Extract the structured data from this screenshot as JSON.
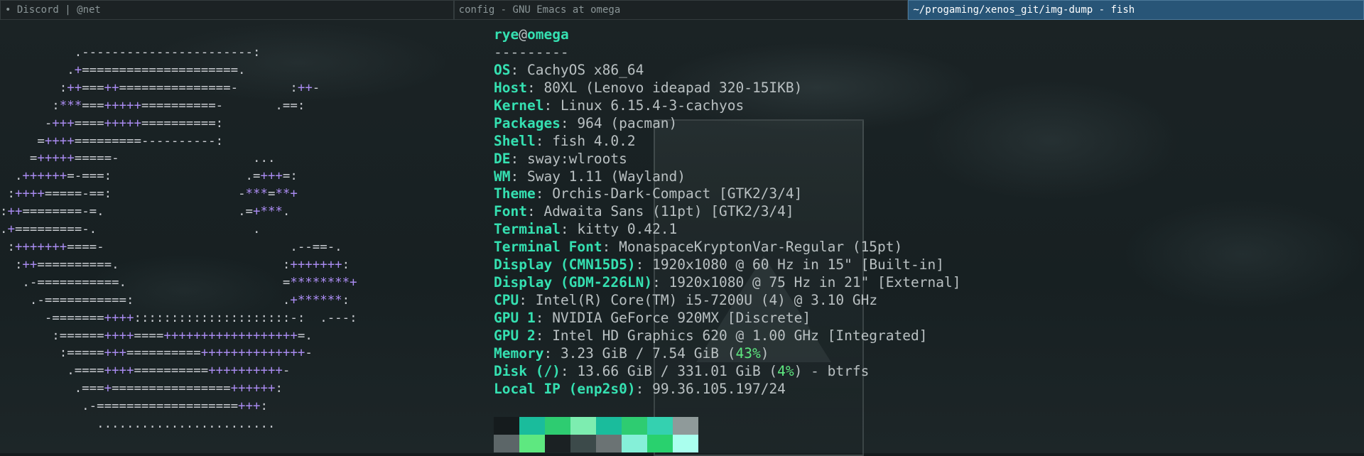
{
  "windows": [
    {
      "title": "• Discord | @net"
    },
    {
      "title": "config - GNU Emacs at omega"
    },
    {
      "title": "~/progaming/xenos_git/img-dump - fish"
    }
  ],
  "ascii_art": [
    "          .-----------------------:",
    "         .+=====================.",
    "        :++===++===============-       :++-",
    "       :***===+++++==========-       .==:",
    "      -+++====+++++==========:",
    "     =++++=========----------:",
    "    =+++++=====-                  ...",
    "  .++++++=-===:                  .=+++=:",
    " :++++=====-==:                 -***=**+",
    ":++========-=.                  .=+***.",
    ".+=========-.                     .",
    " :+++++++====-                         .--==-.",
    "  :++==========.                      :+++++++:",
    "   .-===========.                     =********+",
    "    .-===========:                    .+******:",
    "      -=======++++:::::::::::::::::::::-:  .---:",
    "       :======++++====++++++++++++++++++=.",
    "        :=====+++==========++++++++++++++-",
    "         .====++++==========++++++++++-",
    "          .===+================++++++:",
    "           .-===================+++:",
    "             ........................"
  ],
  "user": "rye",
  "at": "@",
  "host": "omega",
  "separator": "---------",
  "info": [
    {
      "key": "OS",
      "value": "CachyOS x86_64"
    },
    {
      "key": "Host",
      "value": "80XL (Lenovo ideapad 320-15IKB)"
    },
    {
      "key": "Kernel",
      "value": "Linux 6.15.4-3-cachyos"
    },
    {
      "key": "Packages",
      "value": "964 (pacman)"
    },
    {
      "key": "Shell",
      "value": "fish 4.0.2"
    },
    {
      "key": "DE",
      "value": "sway:wlroots"
    },
    {
      "key": "WM",
      "value": "Sway 1.11 (Wayland)"
    },
    {
      "key": "Theme",
      "value": "Orchis-Dark-Compact [GTK2/3/4]"
    },
    {
      "key": "Font",
      "value": "Adwaita Sans (11pt) [GTK2/3/4]"
    },
    {
      "key": "Terminal",
      "value": "kitty 0.42.1"
    },
    {
      "key": "Terminal Font",
      "value": "MonaspaceKryptonVar-Regular (15pt)"
    },
    {
      "key": "Display (CMN15D5)",
      "value": "1920x1080 @ 60 Hz in 15\" [Built-in]"
    },
    {
      "key": "Display (GDM-226LN)",
      "value": "1920x1080 @ 75 Hz in 21\" [External]"
    },
    {
      "key": "CPU",
      "value": "Intel(R) Core(TM) i5-7200U (4) @ 3.10 GHz"
    },
    {
      "key": "GPU 1",
      "value": "NVIDIA GeForce 920MX [Discrete]"
    },
    {
      "key": "GPU 2",
      "value": "Intel HD Graphics 620 @ 1.00 GHz [Integrated]"
    }
  ],
  "memory": {
    "key": "Memory",
    "value_pre": "3.23 GiB / 7.54 GiB (",
    "percent": "43%",
    "value_post": ")"
  },
  "disk": {
    "key": "Disk (/)",
    "value_pre": "13.66 GiB / 331.01 GiB (",
    "percent": "4%",
    "value_post": ") - btrfs"
  },
  "local_ip": {
    "key": "Local IP (enp2s0)",
    "value": "99.36.105.197/24"
  },
  "palette": {
    "row1": [
      "#151b1d",
      "#1abc9c",
      "#2ecc71",
      "#7dedb0",
      "#1abc9c",
      "#2ecc71",
      "#34d1b0",
      "#8f9a9a"
    ],
    "row2": [
      "#5c6668",
      "#5ee880",
      "#1b2123",
      "#3c4a4a",
      "#6b7374",
      "#85f0d8",
      "#29d16e",
      "#aaffee"
    ]
  }
}
